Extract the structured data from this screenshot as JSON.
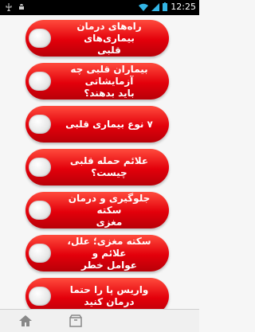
{
  "status": {
    "time": "12:25"
  },
  "items": [
    {
      "line1": "راه‌های درمان بیماری‌های",
      "line2": "قلبی"
    },
    {
      "line1": "بیماران قلبی چه آزمایشاتی",
      "line2": "باید بدهند؟"
    },
    {
      "line1": "۷ نوع بیماری قلبی",
      "line2": ""
    },
    {
      "line1": "علائم حمله قلبی چیست؟",
      "line2": ""
    },
    {
      "line1": "جلوگیری و درمان سکته",
      "line2": "مغزی"
    },
    {
      "line1": "سکته مغزی؛ علل، علائم و",
      "line2": "عوامل خطر"
    },
    {
      "line1": "واریس پا را حتما درمان کنید",
      "line2": ""
    }
  ],
  "icons": [
    "usb-icon",
    "android-icon",
    "wifi-icon",
    "signal-icon",
    "battery-icon",
    "home-icon",
    "box-icon"
  ]
}
